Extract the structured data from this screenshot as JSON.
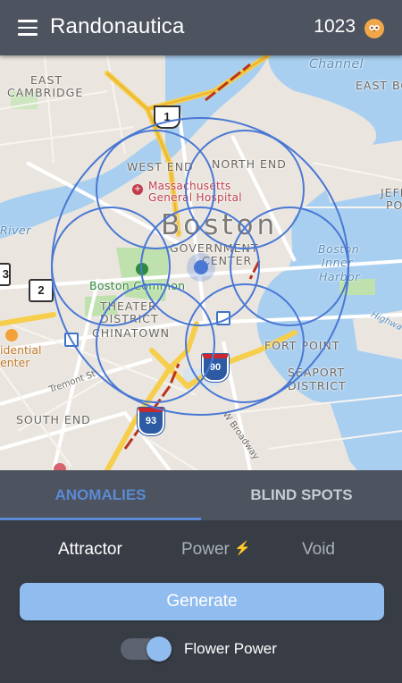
{
  "app": {
    "title": "Randonautica",
    "points": "1023",
    "menu_icon": "hamburger-menu-icon",
    "coin_icon": "owl-coin-icon",
    "accent_color": "#5b8ad6",
    "button_color": "#91bcef"
  },
  "map": {
    "city_label": "Boston",
    "labels": {
      "east_cambridge": [
        "EAST",
        "CAMBRIDGE"
      ],
      "channel": "Channel",
      "east_bo": "EAST BO",
      "west_end": "WEST END",
      "north_end": "NORTH END",
      "hospital": [
        "Massachusetts",
        "General Hospital"
      ],
      "jeff": [
        "JEFF",
        "PO"
      ],
      "river": "River",
      "government_center": [
        "GOVERNMENT",
        "CENTER"
      ],
      "boston_inner_harbor": [
        "Boston",
        "Inner",
        "Harbor"
      ],
      "boston_common": "Boston Common",
      "theater_district": [
        "THEATER",
        "DISTRICT"
      ],
      "chinatown": "CHINATOWN",
      "fort_point": "FORT POINT",
      "seaport": [
        "SEAPORT",
        "DISTRICT"
      ],
      "residential": [
        "idential",
        "enter"
      ],
      "tremont": "Tremont St",
      "south_end": "SOUTH END",
      "w_broadway": "W Broadway",
      "highway": "Highwa"
    },
    "route_shields": {
      "route_1": "1",
      "route_2": "2",
      "route_3": "3",
      "i90": "90",
      "i93": "93"
    },
    "overlay": "flower-of-life-circles"
  },
  "tabs": [
    {
      "label": "ANOMALIES",
      "active": true
    },
    {
      "label": "BLIND SPOTS",
      "active": false
    }
  ],
  "modes": {
    "attractor": "Attractor",
    "power": "Power",
    "power_icon": "lightning-bolt-icon",
    "bolt": "⚡",
    "void": "Void"
  },
  "generate_label": "Generate",
  "flower_power": {
    "label": "Flower Power",
    "enabled": true
  }
}
